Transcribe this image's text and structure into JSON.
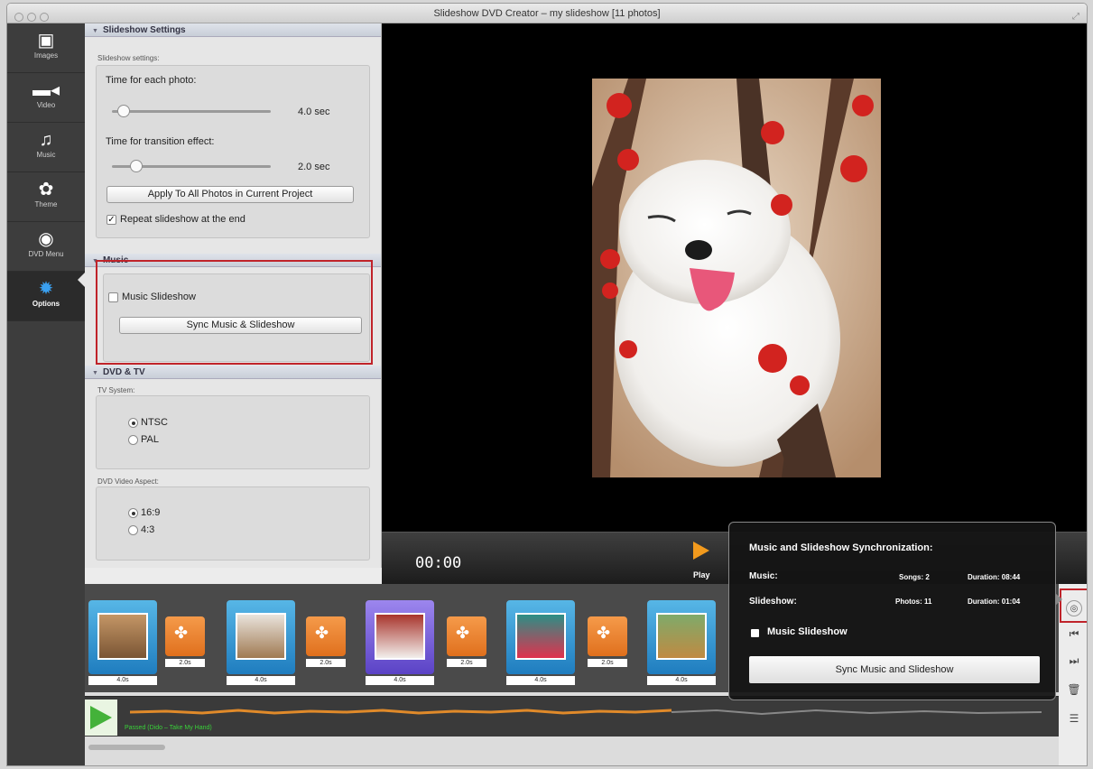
{
  "window": {
    "title": "Slideshow DVD Creator – my slideshow [11 photos]"
  },
  "sidebar": {
    "items": [
      {
        "label": "Images",
        "icon": "image-icon"
      },
      {
        "label": "Video",
        "icon": "video-camera-icon"
      },
      {
        "label": "Music",
        "icon": "music-note-icon"
      },
      {
        "label": "Theme",
        "icon": "palette-icon"
      },
      {
        "label": "DVD Menu",
        "icon": "disc-icon"
      },
      {
        "label": "Options",
        "icon": "gear-icon",
        "active": true
      }
    ]
  },
  "slideshow_settings": {
    "header": "Slideshow Settings",
    "group_label": "Slideshow settings:",
    "time_photo_label": "Time for each photo:",
    "time_photo_value": "4.0 sec",
    "time_transition_label": "Time for transition effect:",
    "time_transition_value": "2.0 sec",
    "apply_button": "Apply To All Photos in Current Project",
    "repeat_label": "Repeat slideshow at the end",
    "repeat_checked": true
  },
  "music": {
    "header": "Music",
    "music_slideshow_label": "Music Slideshow",
    "sync_button": "Sync Music & Slideshow"
  },
  "dvd_tv": {
    "header": "DVD & TV",
    "tv_system_label": "TV System:",
    "ntsc": "NTSC",
    "pal": "PAL",
    "aspect_label": "DVD Video Aspect:",
    "aspect_169": "16:9",
    "aspect_43": "4:3"
  },
  "player": {
    "time": "00:00",
    "play_label": "Play"
  },
  "timeline": {
    "photos": [
      {
        "duration": "4.0s"
      },
      {
        "duration": "4.0s"
      },
      {
        "duration": "4.0s",
        "selected": true
      },
      {
        "duration": "4.0s"
      },
      {
        "duration": "4.0s"
      }
    ],
    "transitions": [
      {
        "duration": "2.0s"
      },
      {
        "duration": "2.0s"
      },
      {
        "duration": "2.0s"
      },
      {
        "duration": "2.0s"
      }
    ],
    "song": "Passed (Dido – Take My Hand)"
  },
  "popover": {
    "title": "Music and Slideshow Synchronization:",
    "music_label": "Music:",
    "songs": "Songs: 2",
    "music_duration": "Duration: 08:44",
    "slideshow_label": "Slideshow:",
    "photos": "Photos: 11",
    "slideshow_duration": "Duration: 01:04",
    "checkbox_label": "Music Slideshow",
    "button": "Sync Music and Slideshow"
  },
  "colors": {
    "accent_red": "#c0232a",
    "play_orange": "#f29a1d",
    "audio_green": "#44b23a"
  }
}
